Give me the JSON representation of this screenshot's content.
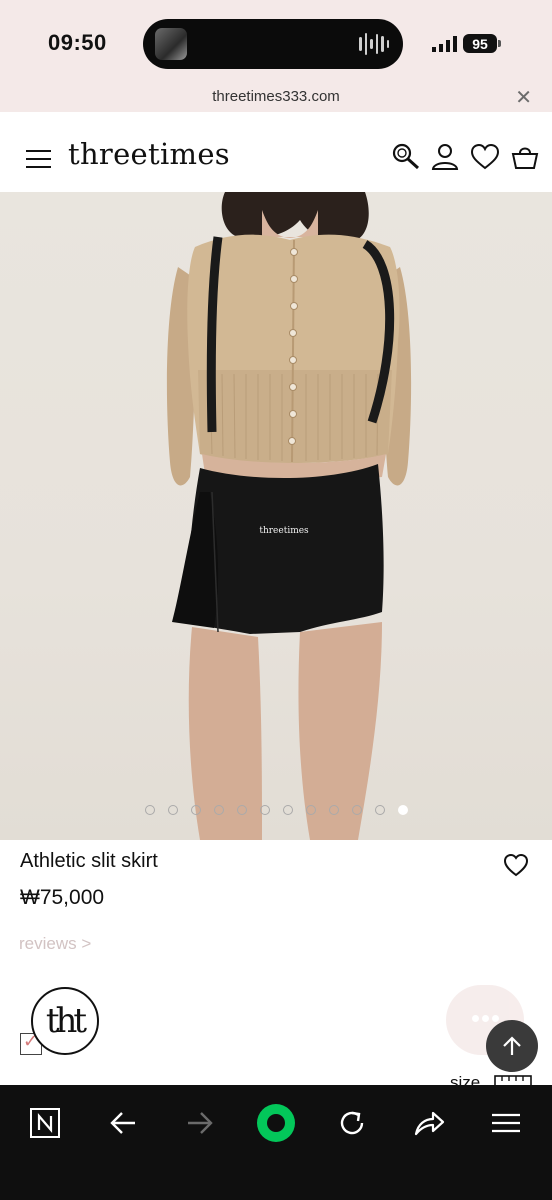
{
  "status_bar": {
    "time": "09:50",
    "battery": "95"
  },
  "url_bar": {
    "url": "threetimes333.com",
    "close_icon": "close-icon"
  },
  "header": {
    "logo": "threetimes",
    "icons": [
      "menu-icon",
      "search-icon",
      "account-icon",
      "wishlist-icon",
      "cart-icon"
    ]
  },
  "hero": {
    "image_label": "threetimes",
    "carousel": {
      "total": 12,
      "active_index": 11
    }
  },
  "product": {
    "title": "Athletic slit skirt",
    "price": "₩75,000",
    "reviews_link": "reviews >"
  },
  "floating": {
    "brand_badge": "tht",
    "size_label": "size"
  },
  "browser_toolbar": {
    "items": [
      "naver-icon",
      "back-icon",
      "forward-icon",
      "green-dot-icon",
      "reload-icon",
      "share-icon",
      "menu-icon"
    ]
  },
  "colors": {
    "status_bg": "#f4e9e8",
    "toolbar_bg": "#0f0f0f",
    "accent_green": "#03c75a",
    "reviews_text": "#d2c3c3"
  }
}
